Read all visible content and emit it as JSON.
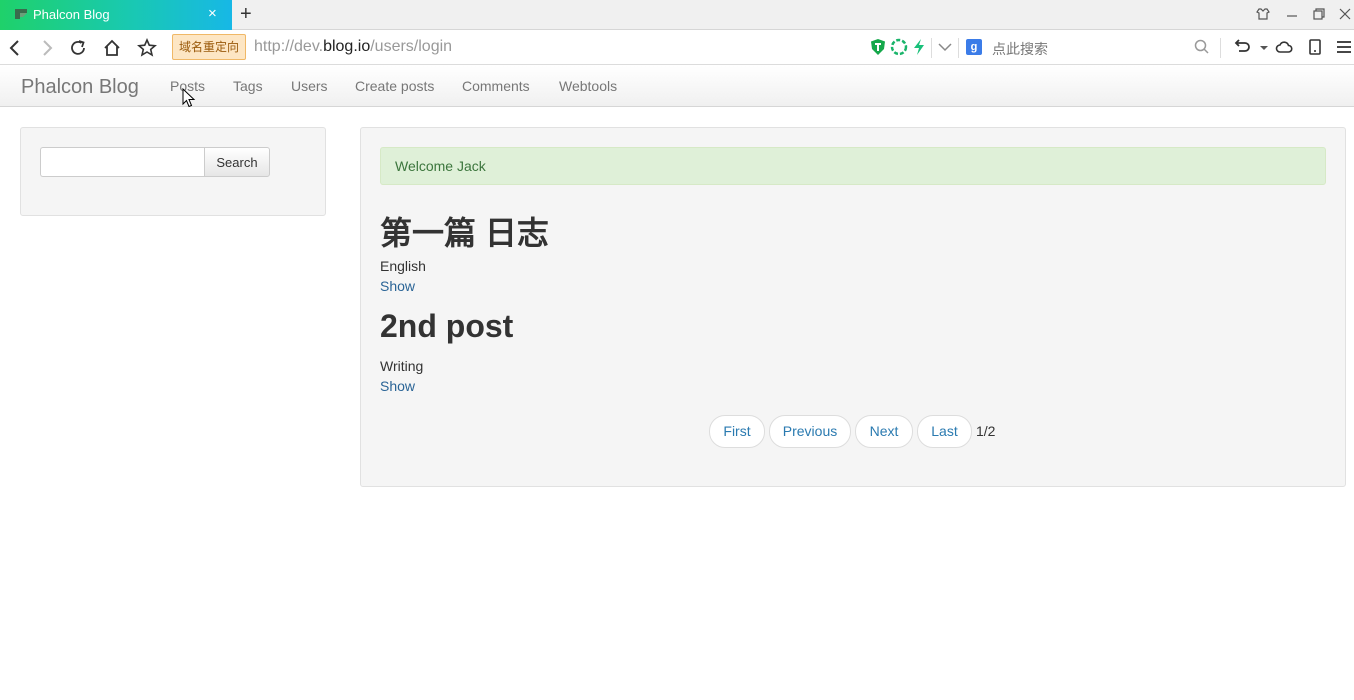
{
  "browser": {
    "tab_title": "Phalcon Blog",
    "tab_close": "×",
    "new_tab": "+",
    "redirect_badge": "域名重定向",
    "url_prefix": "http://dev.",
    "url_host": "blog.io",
    "url_path": "/users/login",
    "search_placeholder": "点此搜索",
    "search_engine_glyph": "g",
    "accent": "#1fd16a"
  },
  "navbar": {
    "brand": "Phalcon Blog",
    "links": [
      "Posts",
      "Tags",
      "Users",
      "Create posts",
      "Comments",
      "Webtools"
    ]
  },
  "sidebar": {
    "search_value": "",
    "search_button": "Search"
  },
  "main": {
    "alert": "Welcome Jack",
    "posts": [
      {
        "title": "第一篇 日志",
        "category": "English",
        "link": "Show"
      },
      {
        "title": "2nd post",
        "category": "Writing",
        "link": "Show"
      }
    ],
    "pagination": {
      "first": "First",
      "previous": "Previous",
      "next": "Next",
      "last": "Last",
      "count": "1/2"
    }
  }
}
